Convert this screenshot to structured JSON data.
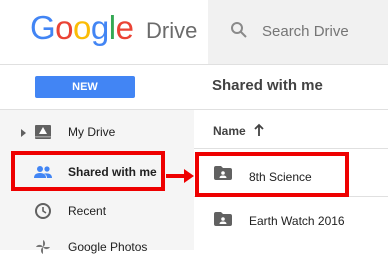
{
  "header": {
    "logo_letters": [
      "G",
      "o",
      "o",
      "g",
      "l",
      "e"
    ],
    "product_name": "Drive",
    "search_placeholder": "Search Drive"
  },
  "toolbar": {
    "new_label": "NEW",
    "title": "Shared with me"
  },
  "sidebar": {
    "items": [
      {
        "label": "My Drive",
        "icon": "drive-icon"
      },
      {
        "label": "Shared with me",
        "icon": "people-icon"
      },
      {
        "label": "Recent",
        "icon": "clock-icon"
      },
      {
        "label": "Google Photos",
        "icon": "photos-icon"
      }
    ]
  },
  "list": {
    "column_name": "Name",
    "files": [
      {
        "name": "8th Science",
        "icon": "shared-folder-icon"
      },
      {
        "name": "Earth Watch 2016",
        "icon": "shared-folder-icon"
      }
    ]
  },
  "colors": {
    "accent": "#4285F4",
    "highlight": "#ee0000",
    "sidebar_bg": "#f5f5f5"
  }
}
